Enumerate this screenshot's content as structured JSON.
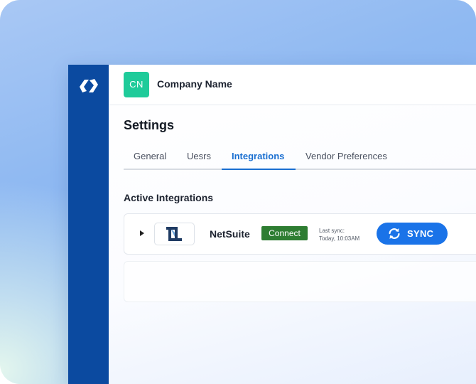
{
  "company": {
    "initials": "CN",
    "name": "Company Name"
  },
  "page": {
    "title": "Settings"
  },
  "tabs": [
    {
      "label": "General",
      "active": false
    },
    {
      "label": "Uesrs",
      "active": false
    },
    {
      "label": "Integrations",
      "active": true
    },
    {
      "label": "Vendor Preferences",
      "active": false
    }
  ],
  "section": {
    "title": "Active Integrations"
  },
  "integrations": [
    {
      "name": "NetSuite",
      "status": "Connect",
      "last_sync_label": "Last sync:",
      "last_sync_value": "Today, 10:03AM",
      "sync_button": "SYNC"
    }
  ],
  "icons": {
    "sidebar_logo": "app-logo-icon",
    "expand": "caret-right-icon",
    "integration_logo": "netsuite-logo-icon",
    "sync": "refresh-icon"
  },
  "colors": {
    "sidebar": "#0b4aa0",
    "accent": "#1a6fd1",
    "avatar": "#1fcb9a",
    "status_connected": "#2e7d32",
    "sync_button": "#1a73e8"
  }
}
